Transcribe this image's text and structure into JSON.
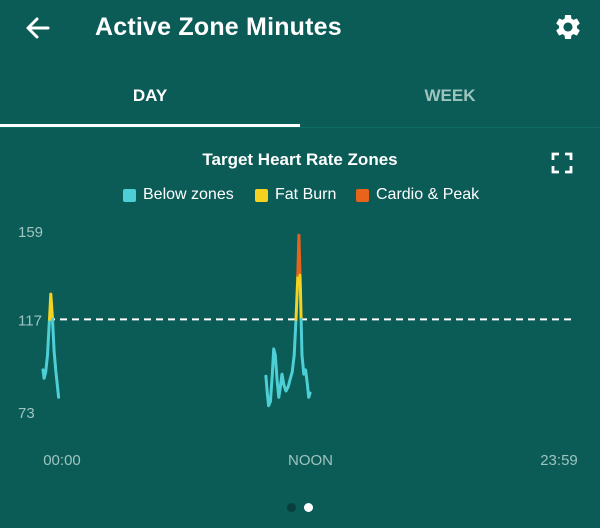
{
  "header": {
    "title": "Active Zone Minutes",
    "back_icon": "arrow-left-icon",
    "settings_icon": "gear-icon"
  },
  "tabs": [
    {
      "label": "DAY",
      "selected": true
    },
    {
      "label": "WEEK",
      "selected": false
    }
  ],
  "chart_header": {
    "title": "Target Heart Rate Zones",
    "expand_icon": "fullscreen-icon"
  },
  "legend": [
    {
      "label": "Below zones",
      "color": "#4ecfd6"
    },
    {
      "label": "Fat Burn",
      "color": "#f4d21f"
    },
    {
      "label": "Cardio & Peak",
      "color": "#e8641c"
    }
  ],
  "pager": {
    "count": 2,
    "active_index": 1
  },
  "colors": {
    "background": "#0b5b57",
    "below": "#4ecfd6",
    "fat_burn": "#f4d21f",
    "cardio_peak": "#e8641c",
    "axis_text": "#9ec4c0"
  },
  "chart_data": {
    "type": "line",
    "title": "Target Heart Rate Zones",
    "xlabel": "",
    "ylabel": "",
    "x_ticks": [
      "00:00",
      "NOON",
      "23:59"
    ],
    "y_ticks": [
      73,
      117,
      159
    ],
    "ylim": [
      73,
      159
    ],
    "xlim_hours": [
      0,
      24
    ],
    "threshold": {
      "value": 117,
      "style": "dashed"
    },
    "zone_limits": {
      "fat_burn": 117,
      "cardio_peak": 138
    },
    "legend": [
      "Below zones",
      "Fat Burn",
      "Cardio & Peak"
    ],
    "series": [
      {
        "points": [
          [
            0.0,
            93
          ],
          [
            0.05,
            89
          ],
          [
            0.12,
            92
          ],
          [
            0.2,
            100
          ],
          [
            0.28,
            115
          ],
          [
            0.35,
            129
          ],
          [
            0.42,
            118
          ],
          [
            0.5,
            102
          ],
          [
            0.58,
            92
          ],
          [
            0.65,
            85
          ],
          [
            0.7,
            80
          ]
        ]
      },
      {
        "points": [
          [
            10.0,
            90
          ],
          [
            10.06,
            82
          ],
          [
            10.12,
            76
          ],
          [
            10.2,
            78
          ],
          [
            10.28,
            90
          ],
          [
            10.35,
            103
          ],
          [
            10.42,
            100
          ],
          [
            10.5,
            88
          ],
          [
            10.58,
            80
          ],
          [
            10.65,
            85
          ],
          [
            10.72,
            91
          ],
          [
            10.8,
            86
          ],
          [
            10.9,
            83
          ],
          [
            11.0,
            85
          ],
          [
            11.1,
            89
          ],
          [
            11.18,
            92
          ],
          [
            11.27,
            100
          ],
          [
            11.35,
            117
          ],
          [
            11.42,
            135
          ],
          [
            11.48,
            157
          ],
          [
            11.55,
            130
          ],
          [
            11.62,
            100
          ],
          [
            11.7,
            91
          ],
          [
            11.78,
            93
          ],
          [
            11.86,
            86
          ],
          [
            11.92,
            80
          ],
          [
            11.98,
            82
          ]
        ]
      }
    ]
  }
}
